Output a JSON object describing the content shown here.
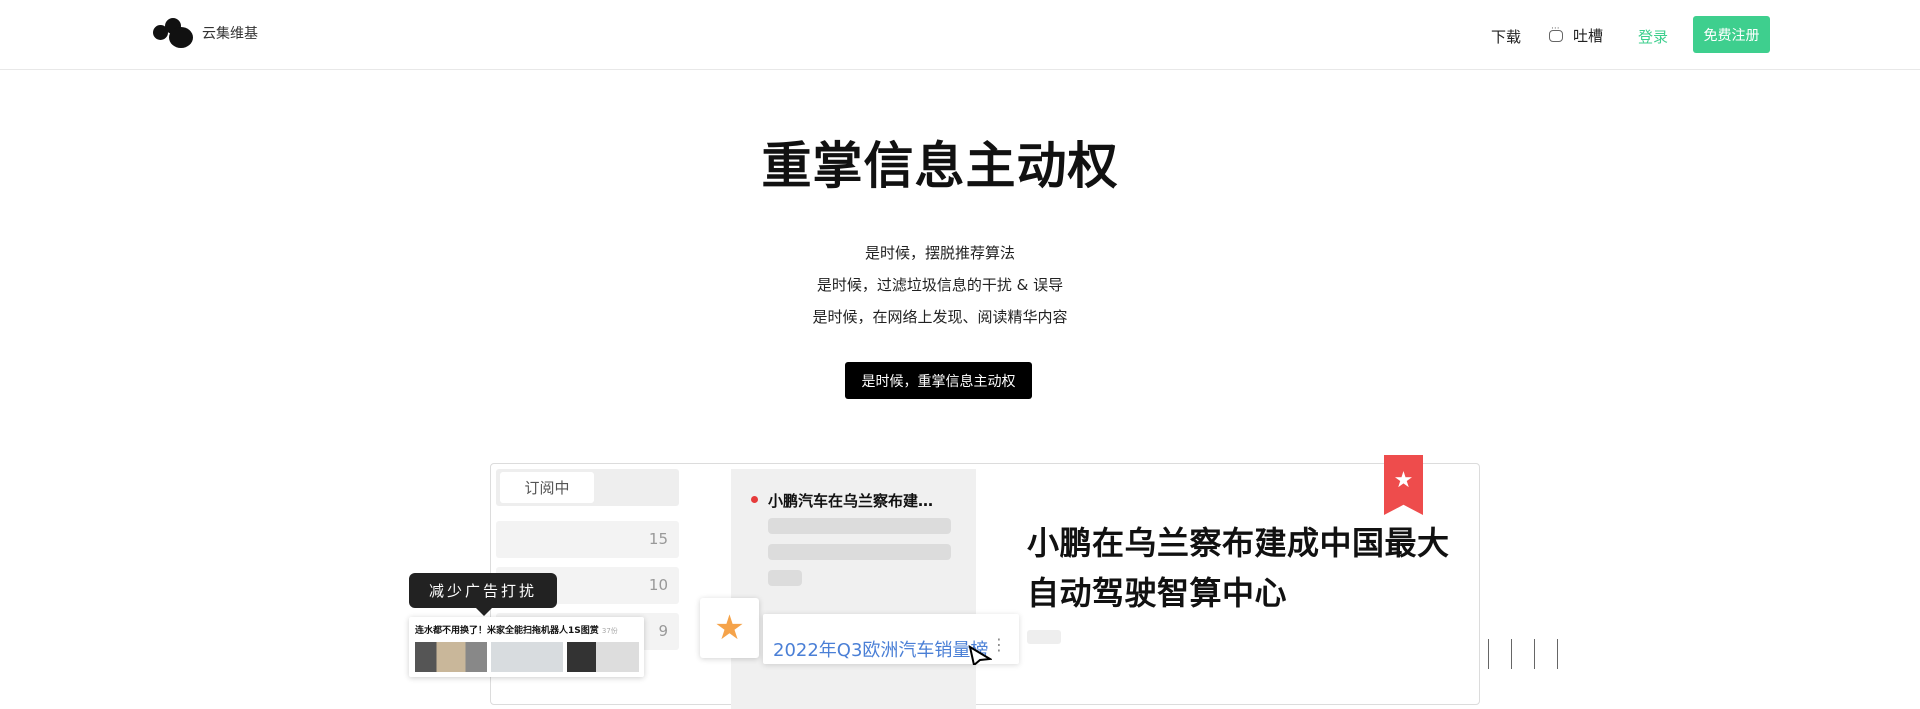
{
  "header": {
    "logo_text": "云集维基",
    "nav": {
      "download": "下载",
      "feedback": "吐槽",
      "feedback_icon": "chat-bubble-icon",
      "login": "登录",
      "register": "免费注册"
    }
  },
  "hero": {
    "title": "重掌信息主动权",
    "lines": [
      "是时候，摆脱推荐算法",
      "是时候，过滤垃圾信息的干扰 & 误导",
      "是时候，在网络上发现、阅读精华内容"
    ],
    "cta": "是时候，重掌信息主动权"
  },
  "preview": {
    "sidebar": {
      "active_tab": "订阅中",
      "counts": [
        "15",
        "10",
        "9"
      ]
    },
    "feed": {
      "item_title": "小鹏汽车在乌兰察布建…"
    },
    "article": {
      "title": "小鹏在乌兰察布建成中国最大自动驾驶智算中心",
      "bookmark_icon": "star-bookmark-icon"
    },
    "overlays": {
      "tooltip": "减少广告打扰",
      "ad_text": "连水都不用换了！米家全能扫拖机器人1S图赏",
      "ad_count": "37份",
      "star_icon": "star-icon",
      "link_text": "2022年Q3欧洲汽车销量榜",
      "more_icon": "more-vertical-icon"
    }
  },
  "colors": {
    "accent_green": "#3ecf8e",
    "bookmark_red": "#ee4c4c",
    "star_orange": "#f5a34a",
    "link_blue": "#4a7fd6"
  }
}
